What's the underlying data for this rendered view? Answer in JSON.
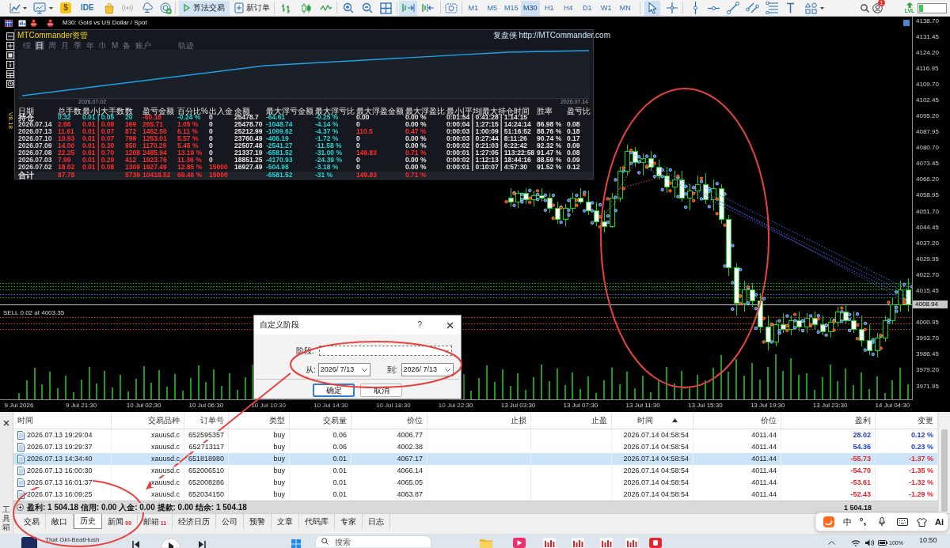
{
  "toolbar": {
    "market_symbol": "$",
    "ide_label": "IDE",
    "algo_trading": {
      "label": "算法交易",
      "on": true
    },
    "new_order": {
      "label": "新订单"
    },
    "toggles": [
      {
        "kind": "auto_scroll",
        "on": true
      },
      {
        "kind": "chart_shift",
        "on": false
      }
    ],
    "timeframes": [
      {
        "label": "M1",
        "selected": false
      },
      {
        "label": "M5",
        "selected": false
      },
      {
        "label": "M15",
        "selected": false
      },
      {
        "label": "M30",
        "selected": true
      },
      {
        "label": "H1",
        "selected": false
      },
      {
        "label": "H4",
        "selected": false
      },
      {
        "label": "D1",
        "selected": false
      },
      {
        "label": "W1",
        "selected": false
      },
      {
        "label": "MN",
        "selected": false
      }
    ],
    "tools": [
      {
        "kind": "cursor",
        "selected": true
      },
      {
        "kind": "crosshair",
        "selected": false
      },
      {
        "kind": "vertical_line",
        "selected": false
      },
      {
        "kind": "horizontal_line",
        "selected": false
      },
      {
        "kind": "trend_line",
        "selected": false
      },
      {
        "kind": "channel",
        "selected": false
      },
      {
        "kind": "fibonacci",
        "selected": false
      },
      {
        "kind": "text",
        "selected": false
      },
      {
        "kind": "shapes",
        "selected": false
      }
    ],
    "notification_count": "1",
    "level_label": "LVL",
    "meter": {
      "level": 0.15
    }
  },
  "chart": {
    "title": "M30: Gold vs US Dollar / Spot",
    "chart_data": [
      {
        "type": "candlestick",
        "categories": [
          "9 Jul 2026",
          null,
          null,
          null,
          null,
          null,
          null,
          null,
          "9 Jul 21:30",
          null,
          null,
          null,
          null,
          null,
          null,
          null,
          "10 Jul 02:30",
          null,
          null,
          null,
          null,
          null,
          null,
          null,
          "10 Jul 06:30",
          null,
          null,
          null,
          null,
          null,
          null,
          null,
          "10 Jul 10:30",
          null,
          null,
          null,
          null,
          null,
          null,
          null,
          "10 Jul 14:30",
          null,
          null,
          null,
          null,
          null,
          null,
          null,
          "10 Jul 18:30",
          null,
          null,
          null,
          null,
          null,
          null,
          null,
          "10 Jul 22:30",
          null,
          null,
          null,
          null,
          null,
          null,
          null,
          "13 Jul 03:30",
          null,
          null,
          null,
          null,
          null,
          null,
          null,
          "13 Jul 07:30",
          null,
          null,
          null,
          null,
          null,
          null,
          null,
          "13 Jul 11:30",
          null,
          null,
          null,
          null,
          null,
          null,
          null,
          "13 Jul 15:30",
          null,
          null,
          null,
          null,
          null,
          null,
          null,
          "13 Jul 19:30",
          null,
          null,
          null,
          null,
          null,
          null,
          null,
          "13 Jul 23:30",
          null,
          null,
          null,
          null,
          null,
          null,
          null,
          "14 Jul 04:30",
          null,
          null
        ],
        "ohlc": [
          null,
          null,
          null,
          null,
          null,
          null,
          null,
          null,
          null,
          null,
          null,
          null,
          null,
          null,
          null,
          null,
          null,
          null,
          null,
          null,
          null,
          null,
          null,
          null,
          null,
          null,
          null,
          null,
          null,
          null,
          null,
          null,
          null,
          null,
          null,
          null,
          null,
          null,
          null,
          null,
          null,
          null,
          null,
          null,
          null,
          null,
          null,
          null,
          null,
          null,
          null,
          null,
          null,
          null,
          null,
          null,
          null,
          null,
          null,
          null,
          null,
          null,
          null,
          [
            4058,
            4062,
            4054,
            4056
          ],
          [
            4056,
            4061,
            4053,
            4060
          ],
          [
            4060,
            4062,
            4055,
            4057
          ],
          [
            4057,
            4061,
            4054,
            4059
          ],
          [
            4059,
            4062,
            4056,
            4058
          ],
          [
            4058,
            4060,
            4051,
            4053
          ],
          [
            4053,
            4056,
            4046,
            4048
          ],
          [
            4048,
            4055,
            4045,
            4053
          ],
          [
            4053,
            4060,
            4051,
            4058
          ],
          [
            4058,
            4062,
            4055,
            4056
          ],
          [
            4056,
            4061,
            4050,
            4052
          ],
          [
            4052,
            4056,
            4045,
            4047
          ],
          [
            4047,
            4052,
            4042,
            4045
          ],
          [
            4045,
            4060,
            4044,
            4058
          ],
          [
            4058,
            4072,
            4056,
            4070
          ],
          [
            4070,
            4082,
            4068,
            4079
          ],
          [
            4079,
            4081,
            4072,
            4074
          ],
          [
            4074,
            4078,
            4068,
            4076
          ],
          [
            4076,
            4079,
            4070,
            4072
          ],
          [
            4072,
            4075,
            4066,
            4068
          ],
          [
            4068,
            4072,
            4060,
            4063
          ],
          [
            4063,
            4070,
            4058,
            4066
          ],
          [
            4066,
            4070,
            4056,
            4058
          ],
          [
            4058,
            4064,
            4052,
            4061
          ],
          [
            4061,
            4068,
            4057,
            4064
          ],
          [
            4064,
            4069,
            4055,
            4057
          ],
          [
            4057,
            4066,
            4052,
            4062
          ],
          [
            4062,
            4064,
            4046,
            4048
          ],
          [
            4048,
            4050,
            4022,
            4026
          ],
          [
            4026,
            4028,
            4004,
            4010
          ],
          [
            4010,
            4020,
            4006,
            4016
          ],
          [
            4016,
            4019,
            4008,
            4011
          ],
          [
            4011,
            4014,
            3996,
            3999
          ],
          [
            3999,
            4004,
            3988,
            3992
          ],
          [
            3992,
            4002,
            3990,
            4000
          ],
          [
            4000,
            4005,
            3996,
            3998
          ],
          [
            3998,
            4004,
            3995,
            4002
          ],
          [
            4002,
            4006,
            3997,
            3999
          ],
          [
            3999,
            4005,
            3996,
            4003
          ],
          [
            4003,
            4006,
            3998,
            4000
          ],
          [
            4000,
            4004,
            3995,
            3997
          ],
          [
            3997,
            4003,
            3994,
            4001
          ],
          [
            4001,
            4008,
            3999,
            4006
          ],
          [
            4006,
            4009,
            4000,
            4002
          ],
          [
            4002,
            4006,
            3996,
            3998
          ],
          [
            3998,
            4004,
            3990,
            3993
          ],
          [
            3993,
            4000,
            3986,
            3988
          ],
          [
            3988,
            3996,
            3985,
            3994
          ],
          [
            3994,
            4004,
            3992,
            4002
          ],
          [
            4002,
            4012,
            4000,
            4009
          ],
          [
            4009,
            4020,
            4006,
            4016
          ],
          [
            4016,
            4021,
            4006,
            4008.94
          ]
        ],
        "ylim": [
          3965.8,
          4140.5
        ],
        "yticks": [
          {
            "value": 4138.7,
            "label": "4138.70"
          },
          4131.45,
          {
            "value": 4124.2,
            "label": "4124.20"
          },
          4116.95,
          {
            "value": 4109.7,
            "label": "4109.70"
          },
          4102.45,
          {
            "value": 4095.2,
            "label": "4095.20"
          },
          4087.95,
          {
            "value": 4080.7,
            "label": "4080.70"
          },
          4073.45,
          {
            "value": 4066.2,
            "label": "4066.20"
          },
          4058.95,
          {
            "value": 4051.7,
            "label": "4051.70"
          },
          4044.45,
          {
            "value": 4037.2,
            "label": "4037.20"
          },
          4029.95,
          {
            "value": 4022.7,
            "label": "4022.70"
          },
          4015.45,
          4000.95,
          {
            "value": 3993.7,
            "label": "3993.70"
          },
          3986.45,
          {
            "value": 3979.2,
            "label": "3979.20"
          },
          3971.95
        ],
        "ref_lines": [
          {
            "axis": "y",
            "value": 4008.94,
            "label": "4008.94",
            "color": "#c8c8c8",
            "line_style": "solid"
          },
          {
            "axis": "y",
            "value": 4018.9,
            "color": "#16b816",
            "line_style": "dotted"
          },
          {
            "axis": "y",
            "value": 4017.4,
            "color": "#16b816",
            "line_style": "dotted"
          },
          {
            "axis": "y",
            "value": 4015.9,
            "color": "#16b816",
            "line_style": "dotted"
          },
          {
            "axis": "y",
            "value": 4013.9,
            "color": "#3a6dff",
            "line_style": "dotted"
          },
          {
            "axis": "y",
            "value": 4012.4,
            "color": "#16b816",
            "line_style": "dotted"
          },
          {
            "axis": "y",
            "value": 4003.35,
            "label": "SELL 0.02 at 4003.35",
            "color": "#e03a3a",
            "line_style": "dotted"
          },
          {
            "axis": "y",
            "value": 4000.6,
            "color": "#e03a3a",
            "line_style": "dotted"
          },
          {
            "axis": "y",
            "value": 3997.8,
            "color": "#e03a3a",
            "line_style": "dotted"
          }
        ]
      }
    ]
  },
  "panel": {
    "title": "MTCommander资管",
    "link": "复盘侠 http://MTCommander.com",
    "version": "V8.18",
    "tabs": [
      {
        "label": "综",
        "selected": false
      },
      {
        "label": "日",
        "selected": true
      },
      {
        "label": "周",
        "selected": false
      },
      {
        "label": "月",
        "selected": false
      },
      {
        "label": "季",
        "selected": false
      },
      {
        "label": "年",
        "selected": false
      },
      {
        "label": "巾",
        "selected": false
      },
      {
        "label": "M",
        "selected": false
      },
      {
        "label": "备",
        "selected": false
      },
      {
        "label": "账户",
        "selected": false
      },
      {
        "label": "轨迹",
        "selected": false
      }
    ],
    "curve_dates": [
      "2026.07.02",
      "2026.07.14"
    ],
    "columns": [
      "日期",
      "总手数",
      "最小|大手数",
      "数",
      "盈亏金额",
      "百分比%",
      "出入金",
      "余额",
      "最大浮亏金额",
      "最大浮亏比",
      "最大浮盈金额",
      "最大浮盈比",
      "最小|平均|最大持仓时间",
      "胜率",
      "盈亏比"
    ],
    "rows": [
      {
        "kind": "open",
        "cells": [
          {
            "text": "持仓",
            "color": "#e6e6e6"
          },
          {
            "text": "0.32",
            "color": "#22d3d3"
          },
          {
            "text": "0.01 | 0.05",
            "color": "#22d3d3"
          },
          {
            "text": "20",
            "color": "#22d3d3"
          },
          {
            "text": "-60.18",
            "color": "#ff2d2d"
          },
          {
            "text": "-0.24 %",
            "color": "#22d3d3"
          },
          {
            "text": "0",
            "color": "#e6e6e6"
          },
          {
            "text": "25478.7",
            "color": "#e6e6e6"
          },
          {
            "text": "-64.61",
            "color": "#22d3d3"
          },
          {
            "text": "-0.25 %",
            "color": "#22d3d3"
          },
          {
            "text": "0.00",
            "color": "#e6e6e6"
          },
          {
            "text": "0.00 %",
            "color": "#e6e6e6"
          },
          {
            "text": "0:01:54 | 0:41:28 | 1:14:15",
            "color": "#e6e6e6"
          }
        ]
      },
      {
        "kind": "day",
        "cells": [
          {
            "text": "2026.07.14",
            "color": "#d6d6d6"
          },
          {
            "text": "2.66",
            "color": "#ff2d2d"
          },
          {
            "text": "0.01 | 0.08",
            "color": "#ff2d2d"
          },
          {
            "text": "169",
            "color": "#ff2d2d"
          },
          {
            "text": "265.71",
            "color": "#ff2d2d"
          },
          {
            "text": "1.05 %",
            "color": "#ff2d2d"
          },
          {
            "text": "0",
            "color": "#e6e6e6"
          },
          {
            "text": "25478.70",
            "color": "#e6e6e6"
          },
          {
            "text": "-1048.74",
            "color": "#22d3d3"
          },
          {
            "text": "-4.14 %",
            "color": "#22d3d3"
          },
          {
            "text": "0",
            "color": "#e6e6e6"
          },
          {
            "text": "0.00 %",
            "color": "#e6e6e6"
          },
          {
            "text": "0:00:04 | 1:27:15 | 14:24:14",
            "color": "#e6e6e6"
          },
          {
            "text": "86.98 %",
            "color": "#e6e6e6"
          },
          {
            "text": "0.08",
            "color": "#e6e6e6"
          }
        ]
      },
      {
        "kind": "day",
        "cells": [
          {
            "text": "2026.07.13",
            "color": "#d6d6d6"
          },
          {
            "text": "11.61",
            "color": "#ff2d2d"
          },
          {
            "text": "0.01 | 0.07",
            "color": "#ff2d2d"
          },
          {
            "text": "872",
            "color": "#ff2d2d"
          },
          {
            "text": "1452.50",
            "color": "#ff2d2d"
          },
          {
            "text": "6.11 %",
            "color": "#ff2d2d"
          },
          {
            "text": "0",
            "color": "#e6e6e6"
          },
          {
            "text": "25212.99",
            "color": "#e6e6e6"
          },
          {
            "text": "-1099.62",
            "color": "#22d3d3"
          },
          {
            "text": "-4.37 %",
            "color": "#22d3d3"
          },
          {
            "text": "110.5",
            "color": "#ff2d2d"
          },
          {
            "text": "0.47 %",
            "color": "#ff2d2d"
          },
          {
            "text": "0:00:03 | 1:00:09 | 51:16:52",
            "color": "#e6e6e6"
          },
          {
            "text": "88.76 %",
            "color": "#e6e6e6"
          },
          {
            "text": "0.18",
            "color": "#e6e6e6"
          }
        ]
      },
      {
        "kind": "day",
        "cells": [
          {
            "text": "2026.07.10",
            "color": "#d6d6d6"
          },
          {
            "text": "10.93",
            "color": "#ff2d2d"
          },
          {
            "text": "0.01 | 0.07",
            "color": "#ff2d2d"
          },
          {
            "text": "799",
            "color": "#ff2d2d"
          },
          {
            "text": "1253.01",
            "color": "#ff2d2d"
          },
          {
            "text": "5.57 %",
            "color": "#ff2d2d"
          },
          {
            "text": "0",
            "color": "#e6e6e6"
          },
          {
            "text": "23760.49",
            "color": "#e6e6e6"
          },
          {
            "text": "-406.19",
            "color": "#22d3d3"
          },
          {
            "text": "-1.72 %",
            "color": "#22d3d3"
          },
          {
            "text": "0",
            "color": "#e6e6e6"
          },
          {
            "text": "0.00 %",
            "color": "#e6e6e6"
          },
          {
            "text": "0:00:03 | 0:27:44 | 8:11:26",
            "color": "#e6e6e6"
          },
          {
            "text": "90.74 %",
            "color": "#e6e6e6"
          },
          {
            "text": "0.17",
            "color": "#e6e6e6"
          }
        ]
      },
      {
        "kind": "day",
        "cells": [
          {
            "text": "2026.07.09",
            "color": "#d6d6d6"
          },
          {
            "text": "14.00",
            "color": "#ff2d2d"
          },
          {
            "text": "0.01 | 0.30",
            "color": "#ff2d2d"
          },
          {
            "text": "950",
            "color": "#ff2d2d"
          },
          {
            "text": "1170.29",
            "color": "#ff2d2d"
          },
          {
            "text": "5.48 %",
            "color": "#ff2d2d"
          },
          {
            "text": "0",
            "color": "#e6e6e6"
          },
          {
            "text": "22507.48",
            "color": "#e6e6e6"
          },
          {
            "text": "-2541.27",
            "color": "#22d3d3"
          },
          {
            "text": "-11.58 %",
            "color": "#22d3d3"
          },
          {
            "text": "0",
            "color": "#e6e6e6"
          },
          {
            "text": "0.00 %",
            "color": "#e6e6e6"
          },
          {
            "text": "0:00:02 | 0:21:03 | 6:22:42",
            "color": "#e6e6e6"
          },
          {
            "text": "92.32 %",
            "color": "#e6e6e6"
          },
          {
            "text": "0.09",
            "color": "#e6e6e6"
          }
        ]
      },
      {
        "kind": "day",
        "cells": [
          {
            "text": "2026.07.08",
            "color": "#d6d6d6"
          },
          {
            "text": "22.25",
            "color": "#ff2d2d"
          },
          {
            "text": "0.01 | 0.70",
            "color": "#ff2d2d"
          },
          {
            "text": "1208",
            "color": "#ff2d2d"
          },
          {
            "text": "2485.94",
            "color": "#ff2d2d"
          },
          {
            "text": "13.19 %",
            "color": "#ff2d2d"
          },
          {
            "text": "0",
            "color": "#e6e6e6"
          },
          {
            "text": "21337.19",
            "color": "#e6e6e6"
          },
          {
            "text": "-6581.52",
            "color": "#22d3d3"
          },
          {
            "text": "-31.00 %",
            "color": "#22d3d3"
          },
          {
            "text": "149.83",
            "color": "#ff2d2d"
          },
          {
            "text": "0.71 %",
            "color": "#ff2d2d"
          },
          {
            "text": "0:00:01 | 1:27:05 | 113:22:58",
            "color": "#e6e6e6"
          },
          {
            "text": "91.47 %",
            "color": "#e6e6e6"
          },
          {
            "text": "0.08",
            "color": "#e6e6e6"
          }
        ]
      },
      {
        "kind": "day",
        "cells": [
          {
            "text": "2026.07.03",
            "color": "#d6d6d6"
          },
          {
            "text": "7.99",
            "color": "#ff2d2d"
          },
          {
            "text": "0.01 | 0.29",
            "color": "#ff2d2d"
          },
          {
            "text": "412",
            "color": "#ff2d2d"
          },
          {
            "text": "1923.76",
            "color": "#ff2d2d"
          },
          {
            "text": "11.36 %",
            "color": "#ff2d2d"
          },
          {
            "text": "0",
            "color": "#e6e6e6"
          },
          {
            "text": "18851.25",
            "color": "#e6e6e6"
          },
          {
            "text": "-4170.93",
            "color": "#22d3d3"
          },
          {
            "text": "-24.39 %",
            "color": "#22d3d3"
          },
          {
            "text": "0",
            "color": "#e6e6e6"
          },
          {
            "text": "0.00 %",
            "color": "#e6e6e6"
          },
          {
            "text": "0:00:02 | 1:12:13 | 18:44:16",
            "color": "#e6e6e6"
          },
          {
            "text": "88.59 %",
            "color": "#e6e6e6"
          },
          {
            "text": "0.09",
            "color": "#e6e6e6"
          }
        ]
      },
      {
        "kind": "day",
        "cells": [
          {
            "text": "2026.07.02",
            "color": "#d6d6d6"
          },
          {
            "text": "18.02",
            "color": "#ff2d2d"
          },
          {
            "text": "0.01 | 0.08",
            "color": "#ff2d2d"
          },
          {
            "text": "1309",
            "color": "#ff2d2d"
          },
          {
            "text": "1927.49",
            "color": "#ff2d2d"
          },
          {
            "text": "12.85 %",
            "color": "#ff2d2d"
          },
          {
            "text": "15000",
            "color": "#ff2d2d"
          },
          {
            "text": "16927.49",
            "color": "#e6e6e6"
          },
          {
            "text": "-504.98",
            "color": "#22d3d3"
          },
          {
            "text": "-3.18 %",
            "color": "#22d3d3"
          },
          {
            "text": "0",
            "color": "#e6e6e6"
          },
          {
            "text": "0.00 %",
            "color": "#e6e6e6"
          },
          {
            "text": "0:00:01 | 0:10:07 | 4:57:30",
            "color": "#e6e6e6"
          },
          {
            "text": "91.52 %",
            "color": "#e6e6e6"
          },
          {
            "text": "0.12",
            "color": "#e6e6e6"
          }
        ]
      },
      {
        "kind": "total",
        "cells": [
          {
            "text": "合计",
            "color": "#e6e6e6"
          },
          {
            "text": "87.78",
            "color": "#ff2d2d"
          },
          null,
          {
            "text": "5739",
            "color": "#ff2d2d"
          },
          {
            "text": "10418.52",
            "color": "#ff2d2d"
          },
          {
            "text": "69.46 %",
            "color": "#ff2d2d"
          },
          {
            "text": "15000",
            "color": "#ff2d2d"
          },
          null,
          {
            "text": "-6581.52",
            "color": "#22d3d3"
          },
          {
            "text": "-31 %",
            "color": "#22d3d3"
          },
          {
            "text": "149.83",
            "color": "#ff2d2d"
          },
          {
            "text": "0.71 %",
            "color": "#ff2d2d"
          }
        ]
      }
    ]
  },
  "dialog": {
    "title": "自定义阶段",
    "help_label": "?",
    "period": {
      "label": "阶段:"
    },
    "from": {
      "label": "从:",
      "value": "2026/ 7/13"
    },
    "to": {
      "label": "到:",
      "value": "2026/ 7/13"
    },
    "buttons": [
      {
        "label": "确定",
        "default": true
      },
      {
        "label": "取消",
        "default": false
      }
    ]
  },
  "toolbox": {
    "title": "工具箱",
    "columns": [
      {
        "label": "时间",
        "sorted": false
      },
      {
        "label": "交易品种",
        "sorted": false
      },
      {
        "label": "订单号",
        "sorted": false
      },
      {
        "label": "类型",
        "sorted": false
      },
      {
        "label": "交易量",
        "sorted": false
      },
      {
        "label": "价位",
        "sorted": false
      },
      {
        "label": "止损",
        "sorted": false
      },
      {
        "label": "止盈",
        "sorted": false
      },
      {
        "label": "时间",
        "sorted": true
      },
      {
        "label": "价位",
        "sorted": false
      },
      {
        "label": "盈利",
        "sorted": false
      },
      {
        "label": "变更",
        "sorted": false
      }
    ],
    "rows": [
      {
        "cells": [
          "2026.07.13 19:29:04",
          "xauusd.c",
          "652595357",
          "buy",
          "0.06",
          "4006.77",
          null,
          null,
          "2026.07.14 04:58:54",
          "4011.44",
          "28.02",
          "0.12 %"
        ],
        "selected": false,
        "color": "#1a3fd6"
      },
      {
        "cells": [
          "2026.07.13 19:29:37",
          "xauusd.c",
          "652713117",
          "buy",
          "0.06",
          "4002.38",
          null,
          null,
          "2026.07.14 04:58:54",
          "4011.44",
          "54.36",
          "0.23 %"
        ],
        "selected": false,
        "color": "#1a3fd6"
      },
      {
        "cells": [
          "2026.07.13 14:34:40",
          "xauusd.c",
          "651818980",
          "buy",
          "0.01",
          "4067.17",
          null,
          null,
          "2026.07.14 04:58:54",
          "4011.44",
          "-55.73",
          "-1.37 %"
        ],
        "selected": true,
        "color": "#e8232a"
      },
      {
        "cells": [
          "2026.07.13 16:00:30",
          "xauusd.c",
          "652006510",
          "buy",
          "0.01",
          "4066.14",
          null,
          null,
          "2026.07.14 04:58:54",
          "4011.44",
          "-54.70",
          "-1.35 %"
        ],
        "selected": false,
        "color": "#e8232a"
      },
      {
        "cells": [
          "2026.07.13 16:01:37",
          "xauusd.c",
          "652008286",
          "buy",
          "0.01",
          "4065.05",
          null,
          null,
          "2026.07.14 04:58:54",
          "4011.44",
          "-53.61",
          "-1.32 %"
        ],
        "selected": false,
        "color": "#e8232a"
      },
      {
        "cells": [
          "2026.07.13 16:09:25",
          "xauusd.c",
          "652034150",
          "buy",
          "0.01",
          "4063.87",
          null,
          null,
          "2026.07.14 04:58:54",
          "4011.44",
          "-52.43",
          "-1.29 %"
        ],
        "selected": false,
        "color": "#e8232a"
      }
    ],
    "summary": "盈利: 1 504.18 信用: 0.00 入金: 0.00 提款: 0.00 结余: 1 504.18",
    "total": "1 504.18",
    "tabs": [
      {
        "label": "交易",
        "selected": false
      },
      {
        "label": "敞口",
        "selected": false
      },
      {
        "label": "历史",
        "selected": true
      },
      {
        "label": "新闻",
        "badge": "99",
        "selected": false
      },
      {
        "label": "邮箱",
        "badge": "11",
        "selected": false
      },
      {
        "label": "经济日历",
        "selected": false
      },
      {
        "label": "公司",
        "selected": false
      },
      {
        "label": "预警",
        "selected": false
      },
      {
        "label": "文章",
        "selected": false
      },
      {
        "label": "代码库",
        "selected": false
      },
      {
        "label": "专家",
        "selected": false
      },
      {
        "label": "日志",
        "selected": false
      }
    ]
  },
  "input_method_bar": {
    "mode": "中",
    "ai_label": "Ai"
  },
  "taskbar": {
    "media_title": "That Girl-BeatHush",
    "search_placeholder": "搜索",
    "battery": "100%",
    "clock": "10:50"
  }
}
